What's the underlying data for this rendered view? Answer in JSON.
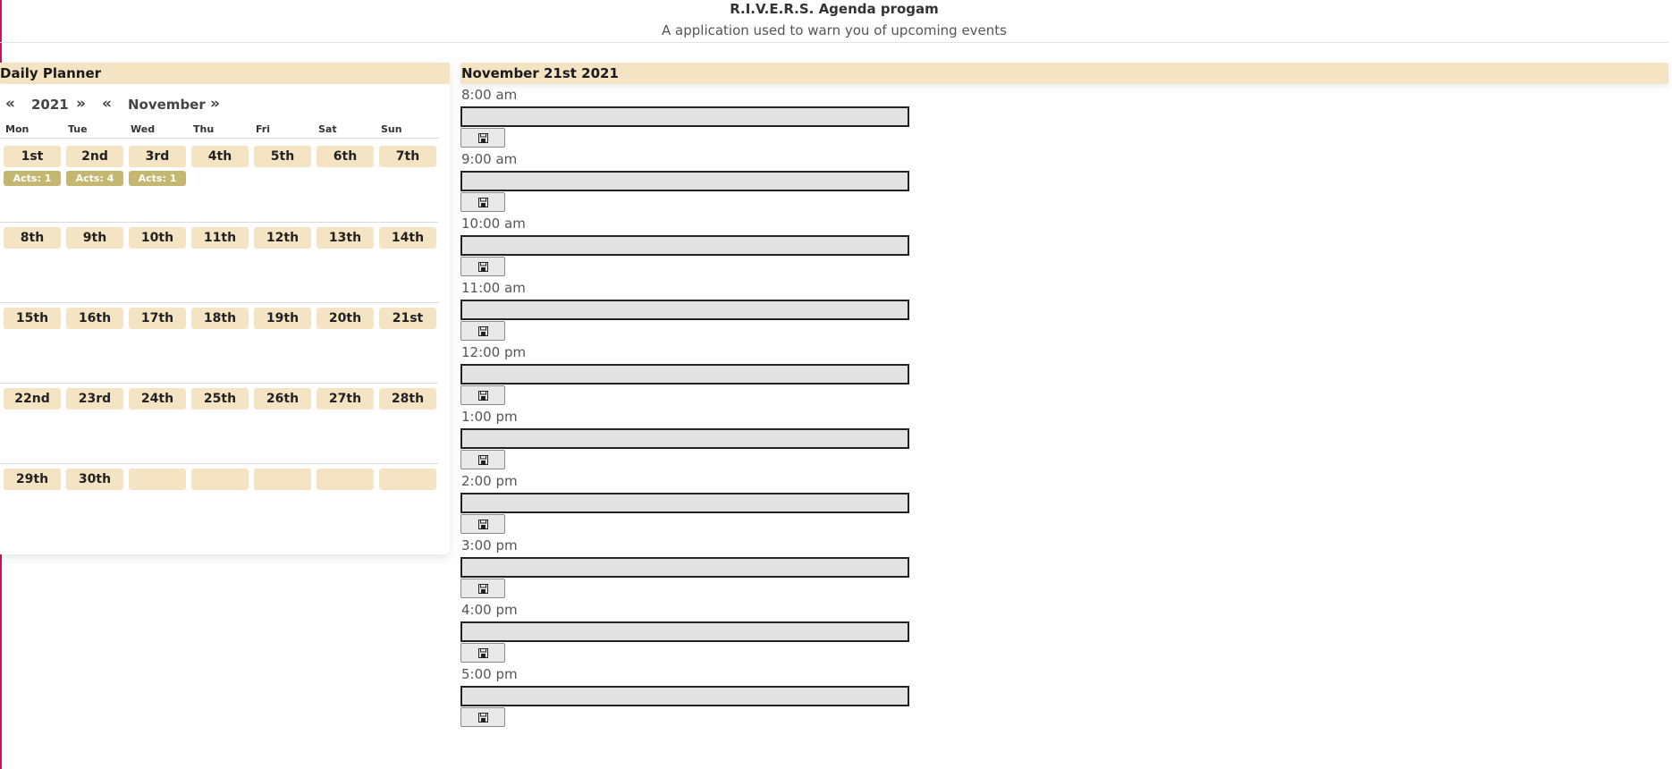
{
  "header": {
    "title": "R.I.V.E.R.S. Agenda progam",
    "subtitle": "A application used to warn you of upcoming events"
  },
  "planner": {
    "title": "Daily Planner",
    "year": "2021",
    "month": "November",
    "prev_symbol": "«",
    "next_symbol": "»",
    "weekdays": [
      "Mon",
      "Tue",
      "Wed",
      "Thu",
      "Fri",
      "Sat",
      "Sun"
    ],
    "weeks": [
      [
        {
          "label": "1st",
          "acts": "Acts: 1"
        },
        {
          "label": "2nd",
          "acts": "Acts: 4"
        },
        {
          "label": "3rd",
          "acts": "Acts: 1"
        },
        {
          "label": "4th"
        },
        {
          "label": "5th"
        },
        {
          "label": "6th"
        },
        {
          "label": "7th"
        }
      ],
      [
        {
          "label": "8th"
        },
        {
          "label": "9th"
        },
        {
          "label": "10th"
        },
        {
          "label": "11th"
        },
        {
          "label": "12th"
        },
        {
          "label": "13th"
        },
        {
          "label": "14th"
        }
      ],
      [
        {
          "label": "15th"
        },
        {
          "label": "16th"
        },
        {
          "label": "17th"
        },
        {
          "label": "18th"
        },
        {
          "label": "19th"
        },
        {
          "label": "20th"
        },
        {
          "label": "21st"
        }
      ],
      [
        {
          "label": "22nd"
        },
        {
          "label": "23rd"
        },
        {
          "label": "24th"
        },
        {
          "label": "25th"
        },
        {
          "label": "26th"
        },
        {
          "label": "27th"
        },
        {
          "label": "28th"
        }
      ],
      [
        {
          "label": "29th"
        },
        {
          "label": "30th"
        },
        {
          "label": ""
        },
        {
          "label": ""
        },
        {
          "label": ""
        },
        {
          "label": ""
        },
        {
          "label": ""
        }
      ]
    ]
  },
  "schedule": {
    "date_title": "November 21st 2021",
    "save_icon": "floppy-disk-icon",
    "slots": [
      {
        "time": "8:00 am",
        "value": ""
      },
      {
        "time": "9:00 am",
        "value": ""
      },
      {
        "time": "10:00 am",
        "value": ""
      },
      {
        "time": "11:00 am",
        "value": ""
      },
      {
        "time": "12:00 pm",
        "value": ""
      },
      {
        "time": "1:00 pm",
        "value": ""
      },
      {
        "time": "2:00 pm",
        "value": ""
      },
      {
        "time": "3:00 pm",
        "value": ""
      },
      {
        "time": "4:00 pm",
        "value": ""
      },
      {
        "time": "5:00 pm",
        "value": ""
      }
    ]
  },
  "colors": {
    "panel_header": "#f5e4c3",
    "day_cell": "#f5e4c3",
    "acts_badge": "#c4b772",
    "input_bg": "#e2e2e2"
  }
}
